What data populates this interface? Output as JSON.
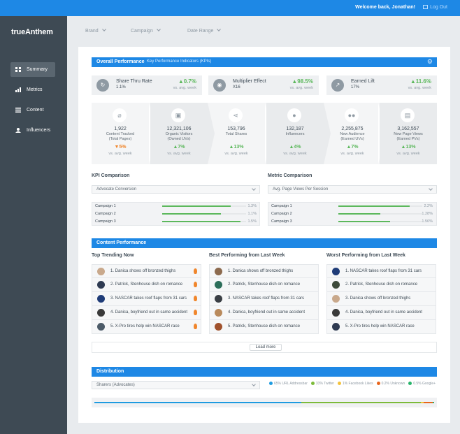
{
  "topbar": {
    "welcome": "Welcome back, Jonathan!",
    "logout": "Log Out"
  },
  "sidebar": {
    "logo": "trueAnthem",
    "items": [
      {
        "label": "Summary",
        "icon": "grid-icon",
        "active": true
      },
      {
        "label": "Metrics",
        "icon": "bar-chart-icon",
        "active": false
      },
      {
        "label": "Content",
        "icon": "list-icon",
        "active": false
      },
      {
        "label": "Influencers",
        "icon": "person-icon",
        "active": false
      }
    ]
  },
  "filters": [
    "Brand",
    "Campaign",
    "Date Range"
  ],
  "overall": {
    "title": "Overall Performance",
    "subtitle": "Key Performance Indicators (KPIs)",
    "kpis": [
      {
        "name": "Share Thru Rate",
        "value": "1.1%",
        "change": "▲0.7%",
        "vs": "vs. avg. week",
        "icon": "refresh-icon"
      },
      {
        "name": "Multiplier Effect",
        "value": "X16",
        "change": "▲98.5%",
        "vs": "vs. avg. week",
        "icon": "eye-icon"
      },
      {
        "name": "Earned Lift",
        "value": "17%",
        "change": "▲11.6%",
        "vs": "vs. avg. week",
        "icon": "arrow-up-right-icon"
      }
    ],
    "funnel": [
      {
        "num": "1,922",
        "label1": "Content Tracked",
        "label2": "(Total Pages)",
        "change": "▼5%",
        "dir": "down",
        "vs": "vs. avg. week",
        "icon": "paperclip-icon"
      },
      {
        "num": "12,321,106",
        "label1": "Organic Visitors",
        "label2": "(Owned UVs)",
        "change": "▲7%",
        "dir": "up",
        "vs": "vs. avg. week",
        "icon": "contact-card-icon"
      },
      {
        "num": "153,796",
        "label1": "Total Shares",
        "label2": "",
        "change": "▲13%",
        "dir": "up",
        "vs": "vs. avg. week",
        "icon": "share-icon"
      },
      {
        "num": "132,187",
        "label1": "Influencers",
        "label2": "",
        "change": "▲4%",
        "dir": "up",
        "vs": "vs. avg. week",
        "icon": "person-icon"
      },
      {
        "num": "2,255,875",
        "label1": "New Audience",
        "label2": "(Earned UVs)",
        "change": "▲7%",
        "dir": "up",
        "vs": "vs. avg. week",
        "icon": "group-icon"
      },
      {
        "num": "3,162,557",
        "label1": "New Page Views",
        "label2": "(Earned PVs)",
        "change": "▲13%",
        "dir": "up",
        "vs": "vs. avg. week",
        "icon": "document-icon"
      }
    ]
  },
  "kpi_comparison": {
    "title": "KPI Comparison",
    "select": "Advocate Conversion",
    "rows": [
      {
        "label": "Campaign 1",
        "value": "1.3%",
        "fill": 0.82
      },
      {
        "label": "Campaign 2",
        "value": "1.1%",
        "fill": 0.7
      },
      {
        "label": "Campaign 3",
        "value": "1.5%",
        "fill": 0.93
      }
    ]
  },
  "metric_comparison": {
    "title": "Metric Comparison",
    "select": "Avg. Page Views Per Session",
    "rows": [
      {
        "label": "Campaign 1",
        "value": "2.2%",
        "fill": 0.85
      },
      {
        "label": "Campaign 2",
        "value": "1.28%",
        "fill": 0.5
      },
      {
        "label": "Campaign 3",
        "value": "1.56%",
        "fill": 0.62
      }
    ]
  },
  "content": {
    "title": "Content Performance",
    "columns": [
      {
        "title": "Top Trending Now",
        "items": [
          {
            "text": "1. Danica shows off bronzed thighs",
            "avatar": "#c9a98c",
            "fire": true
          },
          {
            "text": "2. Patrick, Stenhouse dish on romance",
            "avatar": "#2f3b52",
            "fire": true
          },
          {
            "text": "3. NASCAR takes roof flaps from 31 cars",
            "avatar": "#1f3c78",
            "fire": true
          },
          {
            "text": "4. Danica, boyfriend out in same accident",
            "avatar": "#3a3a3a",
            "fire": true
          },
          {
            "text": "5. X-Pro tires help win NASCAR race",
            "avatar": "#4c5b68",
            "fire": true
          }
        ]
      },
      {
        "title": "Best Performing from Last Week",
        "items": [
          {
            "text": "1. Danica shows off bronzed thighs",
            "avatar": "#8c6a4e",
            "fire": false
          },
          {
            "text": "2. Patrick, Stenhouse dish on romance",
            "avatar": "#2c6e5a",
            "fire": false
          },
          {
            "text": "3. NASCAR takes roof flaps from 31 cars",
            "avatar": "#3a3f45",
            "fire": false
          },
          {
            "text": "4. Danica, boyfriend out in same accident",
            "avatar": "#b98a5c",
            "fire": false
          },
          {
            "text": "5. Patrick, Stenhouse dish on romance",
            "avatar": "#a0522d",
            "fire": false
          }
        ]
      },
      {
        "title": "Worst Performing from Last Week",
        "items": [
          {
            "text": "1. NASCAR takes roof flaps from 31 cars",
            "avatar": "#1f3c78",
            "fire": false
          },
          {
            "text": "2. Patrick, Stenhouse dish on romance",
            "avatar": "#3d4a3a",
            "fire": false
          },
          {
            "text": "3. Danica shows off bronzed thighs",
            "avatar": "#c9a98c",
            "fire": false
          },
          {
            "text": "4. Danica, boyfriend out in same accident",
            "avatar": "#3a3a3a",
            "fire": false
          },
          {
            "text": "5. X-Pro tires help win NASCAR race",
            "avatar": "#2f3b52",
            "fire": false
          }
        ]
      }
    ],
    "load_more": "Load more"
  },
  "distribution": {
    "title": "Distribution",
    "select": "Sharers (Advocates)",
    "legend": [
      {
        "label": "65% URL Addressbar",
        "color": "#1e9be0",
        "share": 0.61
      },
      {
        "label": "33% Twitter",
        "color": "#7dbb3a",
        "share": 0.35
      },
      {
        "label": "1% Facebook Likes",
        "color": "#f3c23c",
        "share": 0.01
      },
      {
        "label": "0.2% Unknown",
        "color": "#e8651c",
        "share": 0.025
      },
      {
        "label": "0.5% Google+",
        "color": "#27b46a",
        "share": 0.005
      }
    ]
  },
  "colors": {
    "accent": "#1e88e5",
    "positive": "#5cb85c",
    "negative": "#f0862c",
    "sidebar": "#3e4a54"
  }
}
